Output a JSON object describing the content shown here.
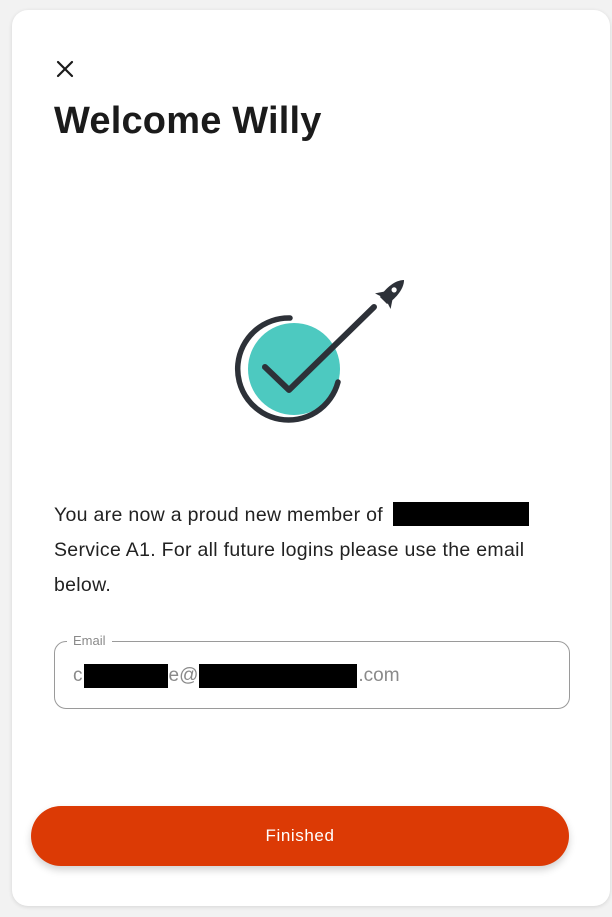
{
  "dialog": {
    "title": "Welcome Willy",
    "close_icon": "close-icon",
    "illustration_icon": "checkmark-rocket-icon"
  },
  "message": {
    "part1": "You are now a proud new member of",
    "part2": "Service A1. For all future logins please use the email below."
  },
  "email": {
    "label": "Email",
    "value_prefix": "c",
    "value_middle": "e@",
    "value_suffix": ".com"
  },
  "actions": {
    "finished_label": "Finished"
  },
  "colors": {
    "accent": "#dc3a05",
    "check_fill": "#4dc9c0",
    "icon_dark": "#2d3138",
    "title_text": "#1b1b1b"
  }
}
